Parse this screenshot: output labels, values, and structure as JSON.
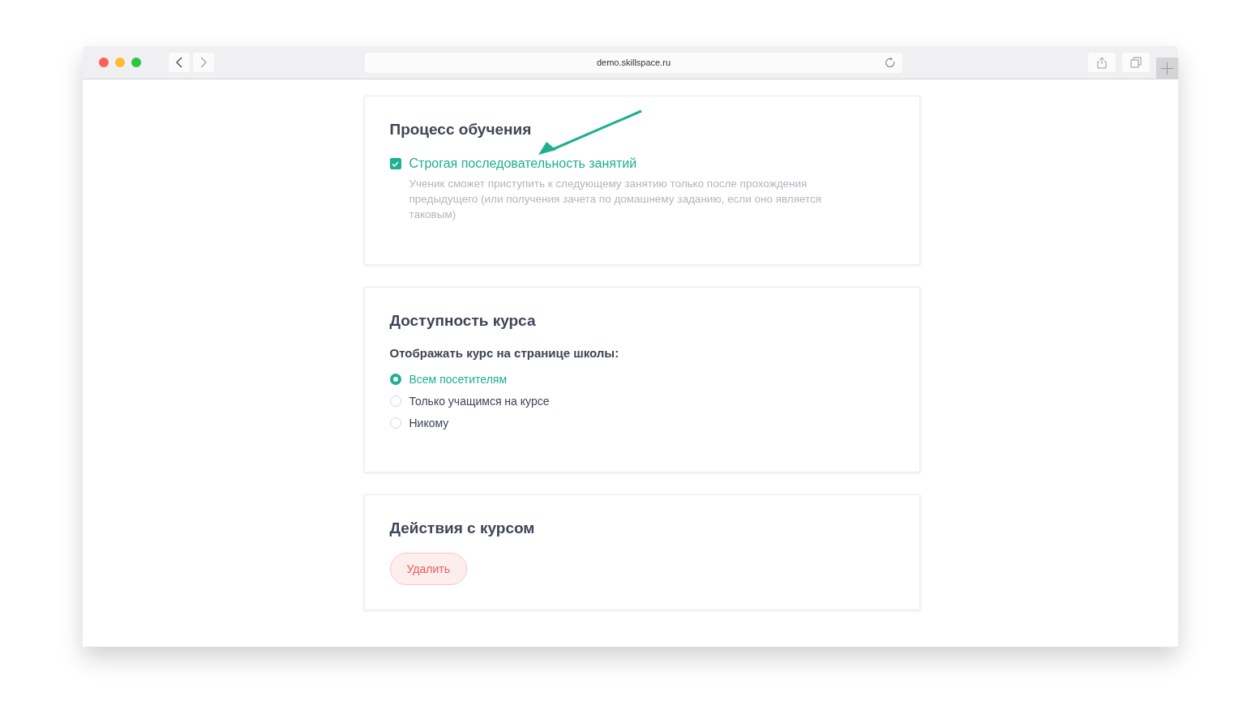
{
  "browser": {
    "url": "demo.skillspace.ru"
  },
  "learning": {
    "title": "Процесс обучения",
    "option": {
      "label": "Строгая последовательность занятий",
      "checked": true,
      "description": "Ученик сможет приступить к следующему занятию только после прохождения предыдущего (или получения зачета по домашнему заданию, если оно является таковым)"
    }
  },
  "availability": {
    "title": "Доступность курса",
    "question": "Отображать курс на странице школы:",
    "options": [
      {
        "label": "Всем посетителям",
        "selected": true
      },
      {
        "label": "Только учащимся на курсе",
        "selected": false
      },
      {
        "label": "Никому",
        "selected": false
      }
    ]
  },
  "actions": {
    "title": "Действия с курсом",
    "buttons": [
      "Удалить"
    ]
  }
}
